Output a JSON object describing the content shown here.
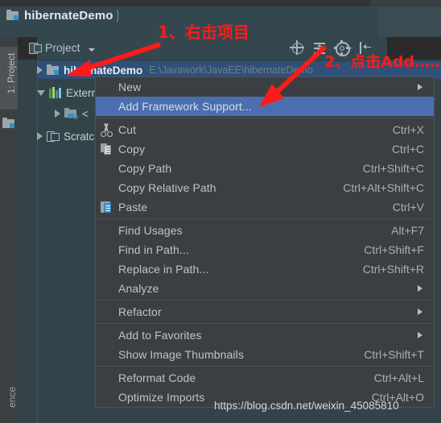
{
  "window": {
    "breadcrumb_project": "hibernateDemo"
  },
  "tool_window": {
    "title": "Project",
    "icons": {
      "locate": "locate-icon",
      "collapse_all": "collapse-all-icon",
      "settings": "gear-icon",
      "hide": "hide-icon"
    }
  },
  "left_strip": {
    "project_tab": "1: Project",
    "bottom_tab": "ence"
  },
  "tree": {
    "nodes": [
      {
        "label": "hibernateDemo",
        "path": "E:\\Javawork\\JavaEE\\hibernateDemo",
        "icon": "module-folder-icon",
        "state": "collapsed",
        "selected": true
      },
      {
        "label": "External Libraries",
        "path": "",
        "icon": "libraries-icon",
        "state": "expanded",
        "selected": false
      },
      {
        "label": "<",
        "path": "",
        "icon": "jdk-folder-icon",
        "state": "collapsed",
        "selected": false
      },
      {
        "label": "Scratches and Consoles",
        "path": "",
        "icon": "scratches-icon",
        "state": "collapsed",
        "selected": false
      }
    ]
  },
  "context_menu": {
    "items": [
      {
        "label": "New",
        "shortcut": "",
        "icon": "",
        "submenu": true,
        "highlighted": false,
        "separator_after": false
      },
      {
        "label": "Add Framework Support...",
        "shortcut": "",
        "icon": "",
        "submenu": false,
        "highlighted": true,
        "separator_after": true
      },
      {
        "label": "Cut",
        "shortcut": "Ctrl+X",
        "icon": "scissors-icon",
        "submenu": false,
        "highlighted": false,
        "separator_after": false
      },
      {
        "label": "Copy",
        "shortcut": "Ctrl+C",
        "icon": "copy-icon",
        "submenu": false,
        "highlighted": false,
        "separator_after": false
      },
      {
        "label": "Copy Path",
        "shortcut": "Ctrl+Shift+C",
        "icon": "",
        "submenu": false,
        "highlighted": false,
        "separator_after": false
      },
      {
        "label": "Copy Relative Path",
        "shortcut": "Ctrl+Alt+Shift+C",
        "icon": "",
        "submenu": false,
        "highlighted": false,
        "separator_after": false
      },
      {
        "label": "Paste",
        "shortcut": "Ctrl+V",
        "icon": "paste-icon",
        "submenu": false,
        "highlighted": false,
        "separator_after": true
      },
      {
        "label": "Find Usages",
        "shortcut": "Alt+F7",
        "icon": "",
        "submenu": false,
        "highlighted": false,
        "separator_after": false
      },
      {
        "label": "Find in Path...",
        "shortcut": "Ctrl+Shift+F",
        "icon": "",
        "submenu": false,
        "highlighted": false,
        "separator_after": false
      },
      {
        "label": "Replace in Path...",
        "shortcut": "Ctrl+Shift+R",
        "icon": "",
        "submenu": false,
        "highlighted": false,
        "separator_after": false
      },
      {
        "label": "Analyze",
        "shortcut": "",
        "icon": "",
        "submenu": true,
        "highlighted": false,
        "separator_after": true
      },
      {
        "label": "Refactor",
        "shortcut": "",
        "icon": "",
        "submenu": true,
        "highlighted": false,
        "separator_after": true
      },
      {
        "label": "Add to Favorites",
        "shortcut": "",
        "icon": "",
        "submenu": true,
        "highlighted": false,
        "separator_after": false
      },
      {
        "label": "Show Image Thumbnails",
        "shortcut": "Ctrl+Shift+T",
        "icon": "",
        "submenu": false,
        "highlighted": false,
        "separator_after": true
      },
      {
        "label": "Reformat Code",
        "shortcut": "Ctrl+Alt+L",
        "icon": "",
        "submenu": false,
        "highlighted": false,
        "separator_after": false
      },
      {
        "label": "Optimize Imports",
        "shortcut": "Ctrl+Alt+O",
        "icon": "",
        "submenu": false,
        "highlighted": false,
        "separator_after": false
      }
    ]
  },
  "annotations": {
    "step1": "1、右击项目",
    "step2": "2、点击Add……",
    "color": "#ff1a1a"
  },
  "watermark": {
    "text": "https://blog.csdn.net/weixin_45085810"
  },
  "colors": {
    "tree_background": "#32444a",
    "menu_background": "#3c3f41",
    "menu_highlight": "#4b6eaf",
    "selection": "#2f5078",
    "accent_blue": "#3592c4"
  }
}
